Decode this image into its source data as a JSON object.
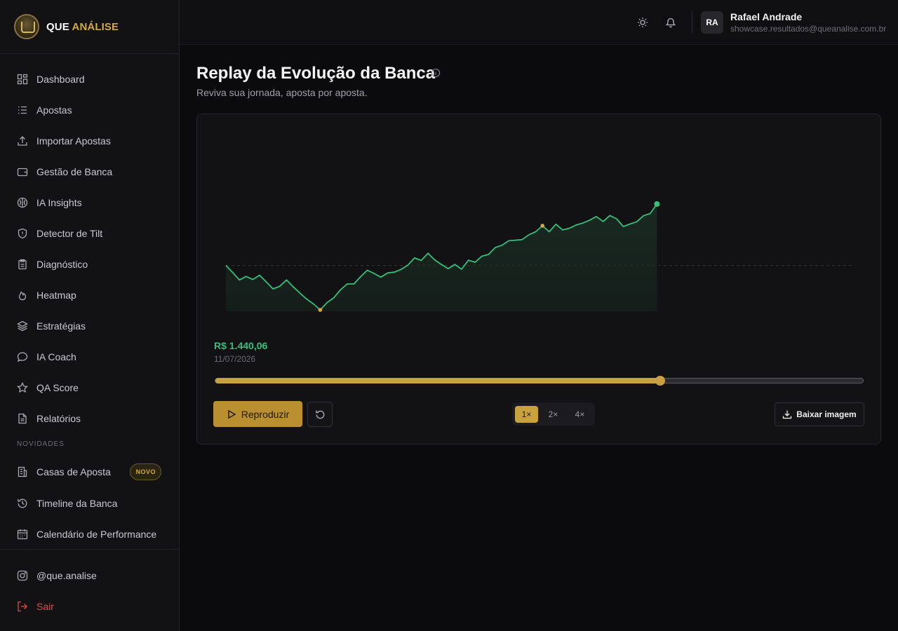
{
  "brand": {
    "part1": "QUE",
    "part2": "ANÁLISE"
  },
  "sidebar": {
    "items": [
      {
        "label": "Dashboard",
        "icon": "dashboard-icon"
      },
      {
        "label": "Apostas",
        "icon": "list-icon"
      },
      {
        "label": "Importar Apostas",
        "icon": "upload-icon"
      },
      {
        "label": "Gestão de Banca",
        "icon": "wallet-icon"
      },
      {
        "label": "IA Insights",
        "icon": "brain-icon"
      },
      {
        "label": "Detector de Tilt",
        "icon": "shield-icon"
      },
      {
        "label": "Diagnóstico",
        "icon": "clipboard-icon"
      },
      {
        "label": "Heatmap",
        "icon": "flame-icon"
      },
      {
        "label": "Estratégias",
        "icon": "layers-icon"
      },
      {
        "label": "IA Coach",
        "icon": "chat-icon"
      },
      {
        "label": "QA Score",
        "icon": "star-icon"
      },
      {
        "label": "Relatórios",
        "icon": "file-icon"
      }
    ],
    "section_label": "NOVIDADES",
    "new_items": [
      {
        "label": "Casas de Aposta",
        "badge": "NOVO",
        "icon": "building-icon"
      },
      {
        "label": "Timeline da Banca",
        "icon": "history-icon"
      },
      {
        "label": "Calendário de Performance",
        "icon": "calendar-icon"
      }
    ],
    "footer": {
      "instagram": "@que.analise",
      "logout": "Sair"
    }
  },
  "header": {
    "user_initials": "RA",
    "user_name": "Rafael Andrade",
    "user_email": "showcase.resultados@queanalise.com.br"
  },
  "page": {
    "title": "Replay da Evolução da Banca",
    "subtitle": "Reviva sua jornada, aposta por aposta."
  },
  "replay": {
    "current_value": "R$ 1.440,06",
    "current_date": "11/07/2026",
    "progress": 0.685,
    "play_label": "Reproduzir",
    "speeds": [
      "1×",
      "2×",
      "4×"
    ],
    "active_speed": "1×",
    "download_label": "Baixar imagem"
  },
  "colors": {
    "accent_gold": "#c9a23e",
    "line_green": "#34c07a",
    "danger": "#e5484d"
  },
  "chart_data": {
    "type": "area",
    "title": "",
    "xlabel": "",
    "ylabel": "",
    "grid": false,
    "legend": "none",
    "baseline_value": 1000,
    "ylim": [
      600,
      2000
    ],
    "x": [
      0,
      1,
      2,
      3,
      4,
      5,
      6,
      7,
      8,
      9,
      10,
      11,
      12,
      13,
      14,
      15,
      16,
      17,
      18,
      19,
      20,
      21,
      22,
      23,
      24,
      25,
      26,
      27,
      28,
      29,
      30,
      31,
      32,
      33,
      34,
      35,
      36,
      37,
      38,
      39,
      40,
      41,
      42,
      43,
      44,
      45,
      46,
      47,
      48,
      49,
      50,
      51,
      52,
      53,
      54,
      55,
      56,
      57,
      58,
      59,
      60,
      61,
      62,
      63,
      64
    ],
    "x_total": 94,
    "series": [
      {
        "values": [
          1000,
          972,
          942,
          956,
          944,
          961,
          934,
          906,
          917,
          942,
          914,
          889,
          865,
          846,
          822,
          851,
          870,
          902,
          926,
          926,
          955,
          981,
          968,
          953,
          970,
          973,
          984,
          1001,
          1030,
          1020,
          1049,
          1022,
          1004,
          987,
          1004,
          985,
          1021,
          1013,
          1037,
          1044,
          1072,
          1081,
          1099,
          1101,
          1104,
          1123,
          1135,
          1159,
          1135,
          1165,
          1142,
          1149,
          1162,
          1170,
          1181,
          1196,
          1176,
          1200,
          1187,
          1156,
          1166,
          1175,
          1199,
          1208,
          1246
        ]
      }
    ],
    "markers": {
      "min": {
        "x": 14,
        "value": 822
      },
      "peak": {
        "x": 47,
        "value": 1159
      },
      "current": {
        "x": 64,
        "value": 1246
      }
    }
  }
}
